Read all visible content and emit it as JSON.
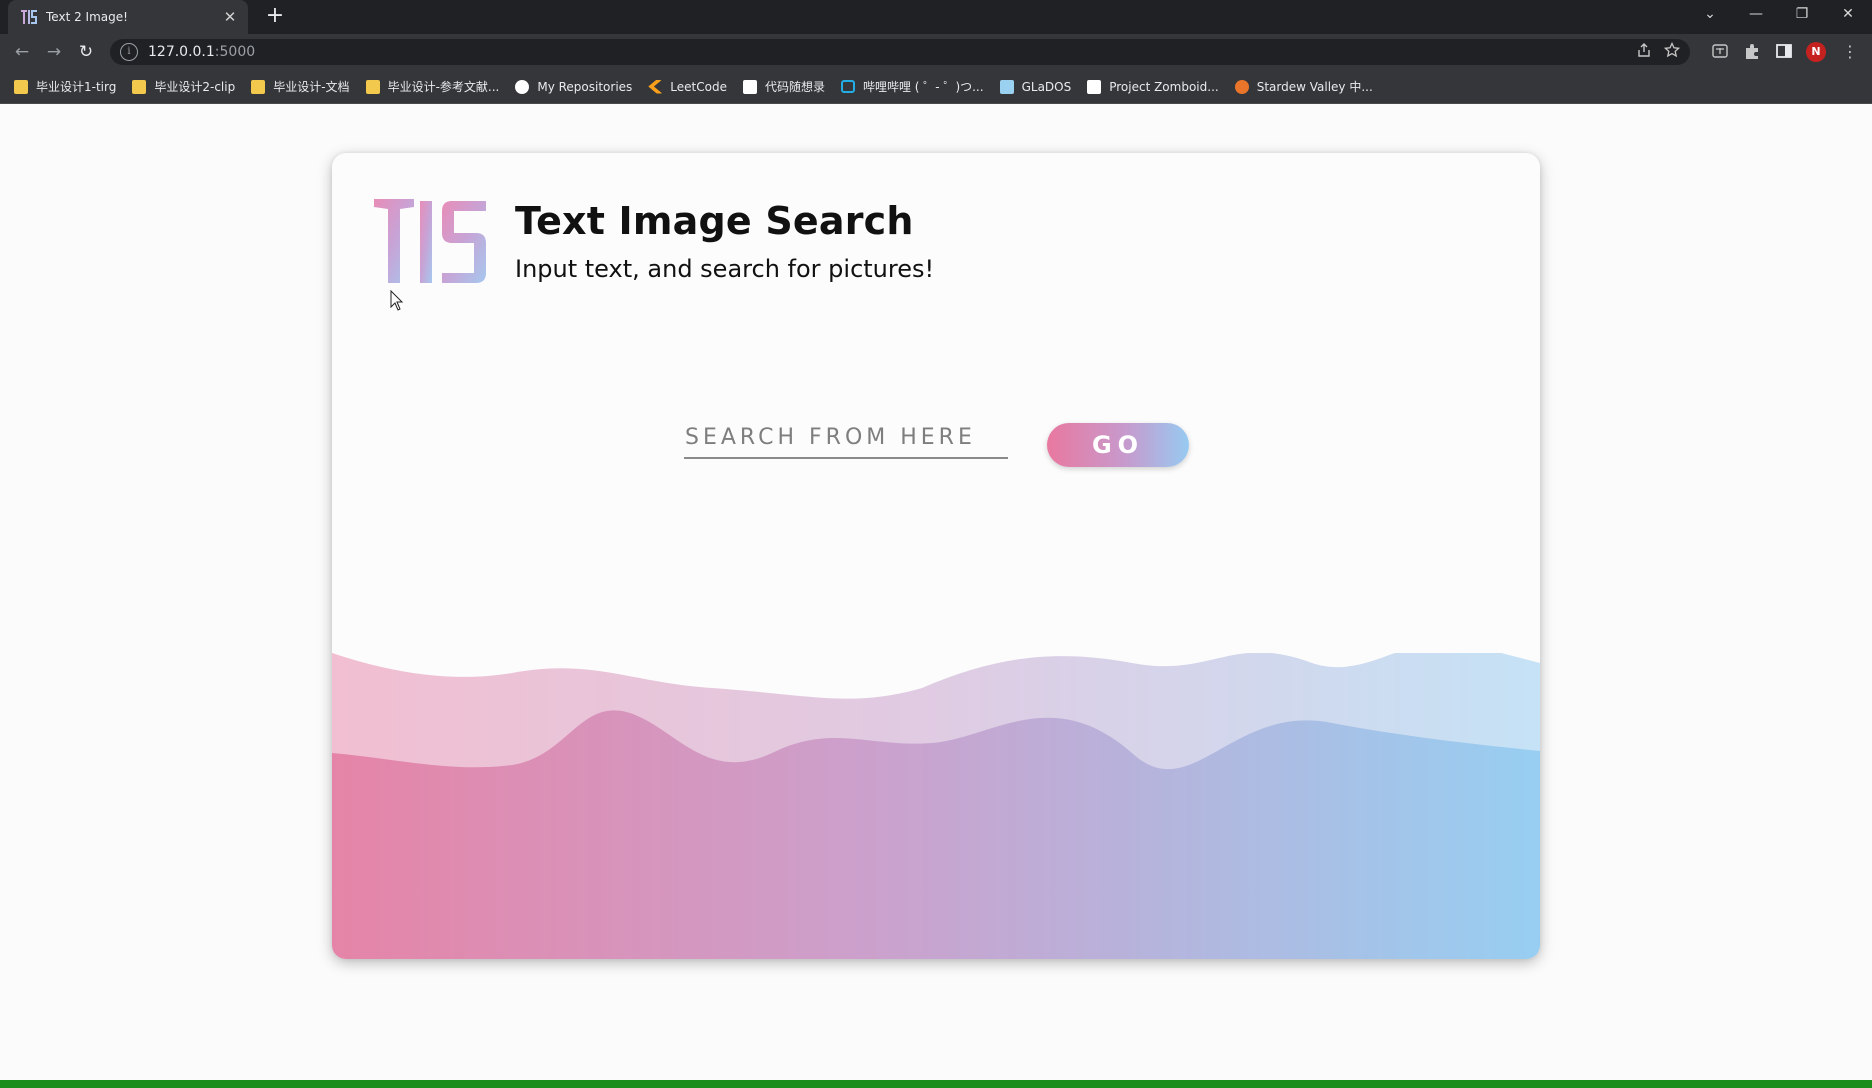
{
  "browser": {
    "tab_title": "Text 2 Image!",
    "tab_close": "✕",
    "new_tab": "+",
    "window_controls": {
      "tabsearch": "⌄",
      "minimize": "—",
      "restore": "❐",
      "close": "✕"
    },
    "nav": {
      "back": "←",
      "forward": "→",
      "reload": "↻"
    },
    "url_host": "127.0.0.1",
    "url_port": ":5000",
    "info_icon": "i",
    "profile_initial": "N",
    "bookmarks": [
      {
        "label": "毕业设计1-tirg",
        "icon": "folder"
      },
      {
        "label": "毕业设计2-clip",
        "icon": "folder"
      },
      {
        "label": "毕业设计-文档",
        "icon": "folder"
      },
      {
        "label": "毕业设计-参考文献...",
        "icon": "folder"
      },
      {
        "label": "My Repositories",
        "icon": "gh"
      },
      {
        "label": "LeetCode",
        "icon": "lc"
      },
      {
        "label": "代码随想录",
        "icon": "code"
      },
      {
        "label": "哔哩哔哩 ( ゜- ゜)つ...",
        "icon": "bili"
      },
      {
        "label": "GLaDOS",
        "icon": "glados"
      },
      {
        "label": "Project Zomboid...",
        "icon": "pz"
      },
      {
        "label": "Stardew Valley 中...",
        "icon": "sv"
      }
    ]
  },
  "page": {
    "logo_text": "TIS",
    "title": "Text Image Search",
    "subtitle": "Input text, and search for pictures!",
    "search": {
      "placeholder": "SEARCH FROM HERE",
      "value": ""
    },
    "go_label": "GO"
  },
  "colors": {
    "accent_pink": "#e9789f",
    "accent_lavender": "#c79acd",
    "accent_blue": "#97caf1"
  }
}
